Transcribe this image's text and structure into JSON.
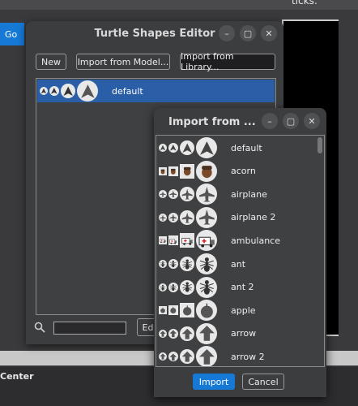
{
  "background": {
    "ticks_label": "ticks:",
    "go_label": "Go",
    "center_label": "Center"
  },
  "editor": {
    "title": "Turtle Shapes Editor",
    "buttons": {
      "new": "New",
      "import_model": "Import from Model...",
      "import_library": "Import from Library...",
      "edit": "Edi"
    },
    "shapes": [
      {
        "name": "default",
        "icon": "arrow-icon"
      }
    ]
  },
  "dialog": {
    "title": "Import from ...",
    "items": [
      {
        "name": "default",
        "icon": "arrow-icon"
      },
      {
        "name": "acorn",
        "icon": "acorn-icon"
      },
      {
        "name": "airplane",
        "icon": "airplane-icon"
      },
      {
        "name": "airplane 2",
        "icon": "airplane-icon"
      },
      {
        "name": "ambulance",
        "icon": "ambulance-icon"
      },
      {
        "name": "ant",
        "icon": "ant-icon"
      },
      {
        "name": "ant 2",
        "icon": "ant-icon"
      },
      {
        "name": "apple",
        "icon": "apple-icon"
      },
      {
        "name": "arrow",
        "icon": "up-arrow-icon"
      },
      {
        "name": "arrow 2",
        "icon": "up-arrow-icon"
      }
    ],
    "import_label": "Import",
    "cancel_label": "Cancel"
  },
  "window_controls": {
    "minimize": "–",
    "maximize": "▢",
    "close": "✕"
  },
  "colors": {
    "accent": "#1679d6",
    "selection": "#2a5fa8"
  }
}
